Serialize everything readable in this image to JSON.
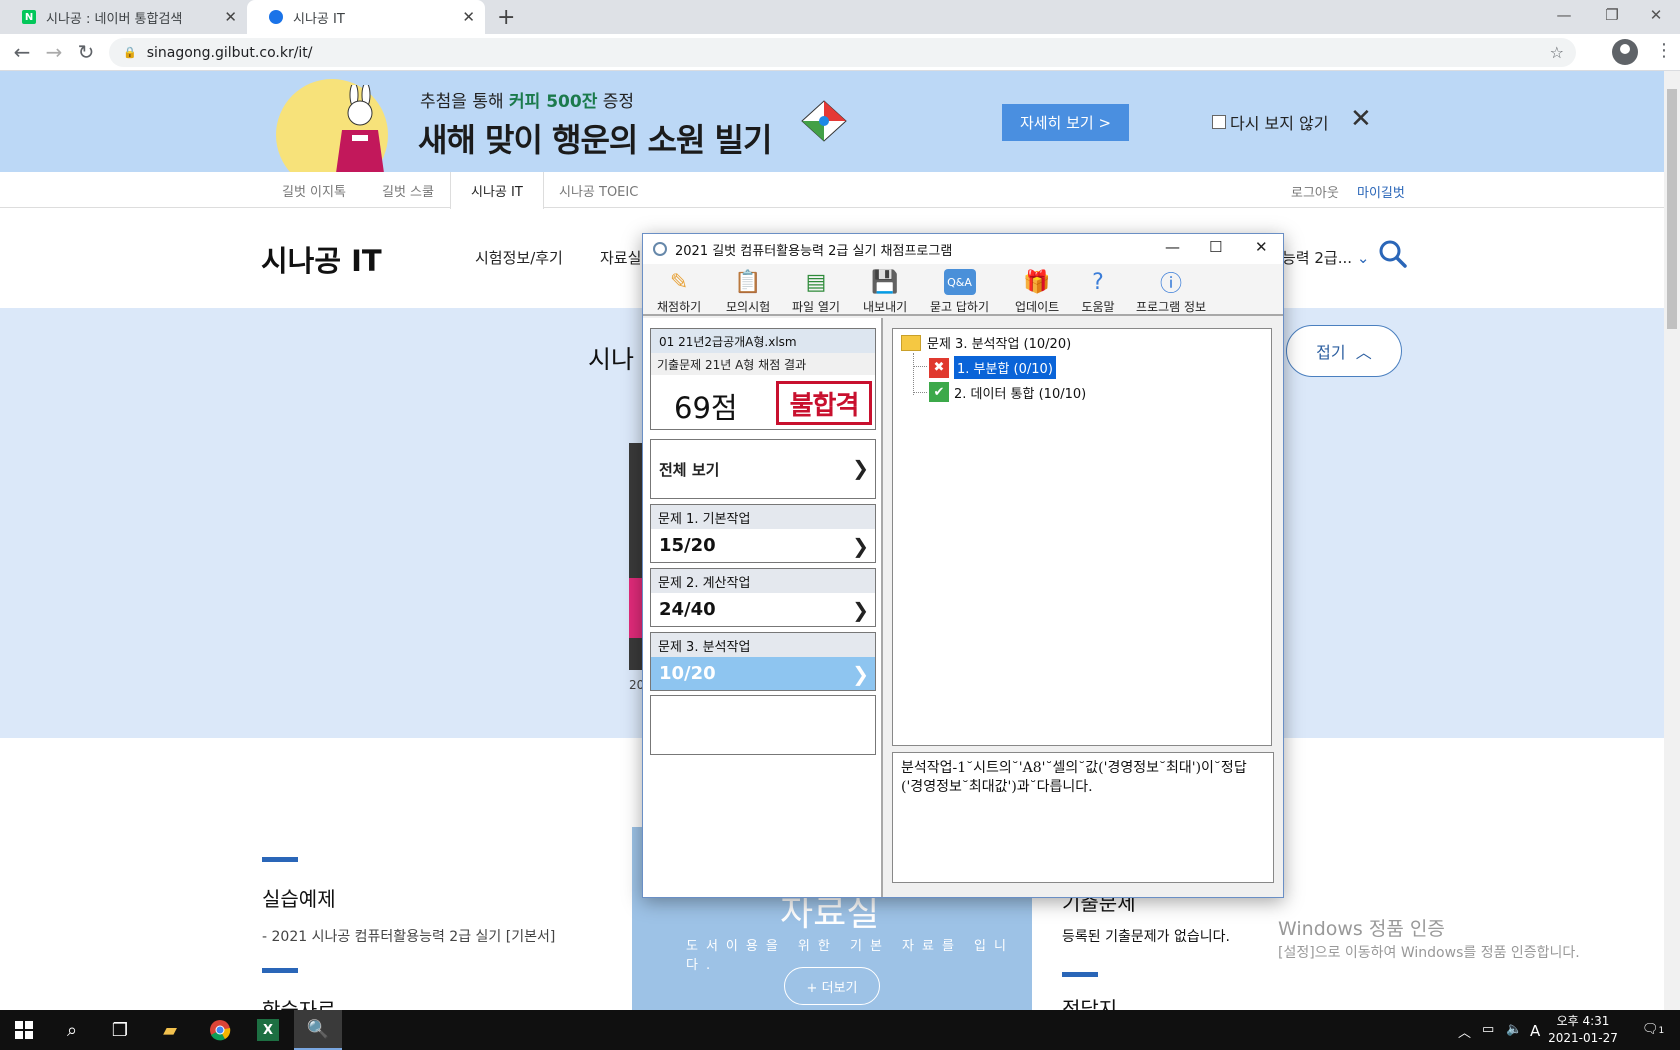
{
  "browser": {
    "tabs": [
      {
        "title": "시나공 : 네이버 통합검색",
        "favicon": "N"
      },
      {
        "title": "시나공 IT",
        "favicon": "gilbut"
      }
    ],
    "url": "sinagong.gilbut.co.kr/it/"
  },
  "banner": {
    "subtitle_prefix": "추첨을 통해 ",
    "subtitle_highlight": "커피 500잔",
    "subtitle_suffix": " 증정",
    "headline": "새해 맞이 행운의 소원 빌기",
    "detail_button": "자세히 보기    >",
    "no_show_label": "다시 보지 않기"
  },
  "site_nav": {
    "items": [
      "길벗 이지톡",
      "길벗 스쿨",
      "시나공 IT",
      "시나공 TOEIC"
    ],
    "logout": "로그아웃",
    "mypage": "마이길벗"
  },
  "header": {
    "logo": "시나공 IT",
    "menu": [
      "시험정보/후기",
      "자료실"
    ],
    "menu_right": "능력 2급..."
  },
  "hero": {
    "title": "시나",
    "fold_button": "접기",
    "year_label": "20"
  },
  "lower": {
    "practice_title": "실습예제",
    "practice_item": "- 2021 시나공 컴퓨터활용능력 2급 실기 [기본서]",
    "study_title": "학습자료",
    "resource_big": "자료실",
    "resource_small": "도서이용을 위한 기본 자료를 입니다.",
    "resource_more": "+ 더보기",
    "exam_title": "기출문제",
    "exam_empty": "등록된 기출문제가 없습니다.",
    "answer_title": "정답지"
  },
  "activation": {
    "title": "Windows 정품 인증",
    "body": "[설정]으로 이동하여 Windows를 정품 인증합니다."
  },
  "grader": {
    "title": "2021 길벗 컴퓨터활용능력 2급 실기 채점프로그램",
    "tools": [
      "채점하기",
      "모의시험",
      "파일 열기",
      "내보내기",
      "묻고 답하기",
      "업데이트",
      "도움말",
      "프로그램 정보"
    ],
    "file_name": "01 21년2급공개A형.xlsm",
    "result_desc": "기출문제 21년 A형 채점 결과",
    "score": "69점",
    "verdict": "불합격",
    "view_all": "전체 보기",
    "sections": [
      {
        "label": "문제 1. 기본작업",
        "score": "15/20",
        "selected": false
      },
      {
        "label": "문제 2. 계산작업",
        "score": "24/40",
        "selected": false
      },
      {
        "label": "문제 3. 분석작업",
        "score": "10/20",
        "selected": true
      }
    ],
    "tree": {
      "root": "문제 3. 분석작업 (10/20)",
      "children": [
        {
          "label": "1. 부분합 (0/10)",
          "status": "wrong",
          "selected": true
        },
        {
          "label": "2. 데이터 통합 (10/10)",
          "status": "correct",
          "selected": false
        }
      ]
    },
    "message": "분석작업-1˘시트의˘'A8'˘셀의˘값('경영정보˘최대')이˘정답('경영정보˘최대값')과˘다릅니다."
  },
  "taskbar": {
    "time": "오후 4:31",
    "date": "2021-01-27",
    "ime": "A",
    "notification_count": "1"
  }
}
